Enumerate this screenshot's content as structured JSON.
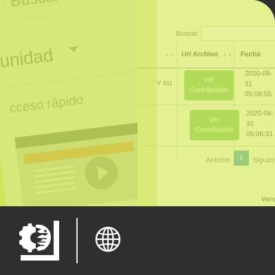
{
  "drive": {
    "search_placeholder": "Buscar en Drive",
    "unit_label": "unidad",
    "quick_access": "cceso rápido"
  },
  "table": {
    "search_label": "Buscar:",
    "columns": [
      "Url Archivo",
      "Fecha"
    ],
    "partial_cell": "Y SU",
    "rows": [
      {
        "button": "Ver Contribución",
        "date": "2020-08-31 05:08:55"
      },
      {
        "button": "Ver Contribución",
        "date": "2020-08-31 05:06:31"
      }
    ],
    "pager": {
      "previous": "Anterior",
      "current_page": "1",
      "next": "Siguien"
    },
    "footer_partial": "Vers"
  },
  "bottom_bar": {
    "logo_icon": "institution-logo-icon",
    "globe_icon": "globe-icon"
  },
  "colors": {
    "tint": "#d6eb5c",
    "button": "#76c154",
    "page_active": "#3c97b8",
    "bar": "#2f2f2f"
  }
}
